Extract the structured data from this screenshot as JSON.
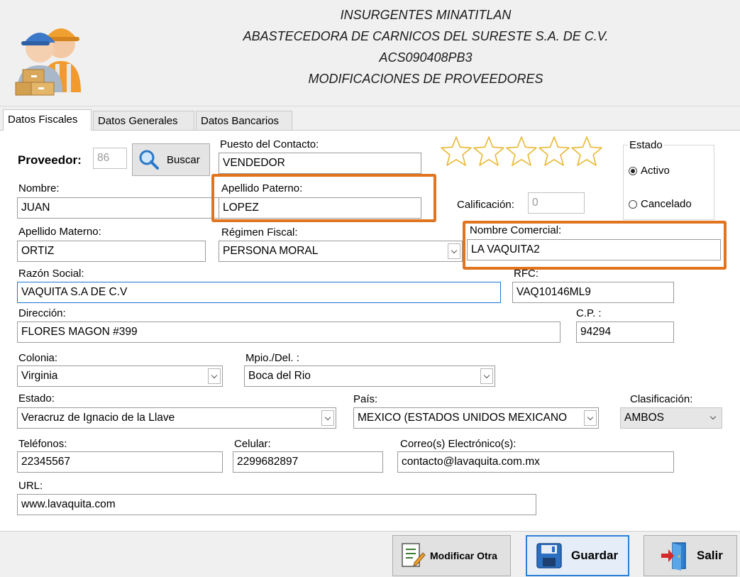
{
  "header": {
    "line1": "INSURGENTES MINATITLAN",
    "line2": "ABASTECEDORA DE CARNICOS DEL SURESTE S.A. DE C.V.",
    "line3": "ACS090408PB3",
    "line4": "MODIFICACIONES DE PROVEEDORES",
    "logo_icon": "suppliers-icon"
  },
  "tabs": [
    {
      "label": "Datos Fiscales",
      "active": true
    },
    {
      "label": "Datos Generales",
      "active": false
    },
    {
      "label": "Datos Bancarios",
      "active": false
    }
  ],
  "form": {
    "proveedor_label": "Proveedor:",
    "proveedor_value": "86",
    "buscar_label": "Buscar",
    "puesto_label": "Puesto del Contacto:",
    "puesto_value": "VENDEDOR",
    "nombre_label": "Nombre:",
    "nombre_value": "JUAN",
    "apellido_paterno_label": "Apellido Paterno:",
    "apellido_paterno_value": "LOPEZ",
    "calificacion_label": "Calificación:",
    "calificacion_value": "0",
    "rating_stars_filled": 0,
    "rating_stars_total": 5,
    "apellido_materno_label": "Apellido Materno:",
    "apellido_materno_value": "ORTIZ",
    "regimen_label": "Régimen Fiscal:",
    "regimen_value": "PERSONA MORAL",
    "nombre_comercial_label": "Nombre Comercial:",
    "nombre_comercial_value": "LA VAQUITA2",
    "razon_label": "Razón Social:",
    "razon_value": "VAQUITA S.A DE C.V",
    "rfc_label": "RFC:",
    "rfc_value": "VAQ10146ML9",
    "direccion_label": "Dirección:",
    "direccion_value": "FLORES MAGON #399",
    "cp_label": "C.P. :",
    "cp_value": "94294",
    "colonia_label": "Colonia:",
    "colonia_value": "Virginia",
    "mpio_label": "Mpio./Del. :",
    "mpio_value": "Boca del Rio",
    "estado_label": "Estado:",
    "estado_value": "Veracruz de Ignacio de la Llave",
    "pais_label": "País:",
    "pais_value": "MEXICO (ESTADOS UNIDOS MEXICANO",
    "clasificacion_label": "Clasificación:",
    "clasificacion_value": "AMBOS",
    "telefonos_label": "Teléfonos:",
    "telefonos_value": "22345567",
    "celular_label": "Celular:",
    "celular_value": "2299682897",
    "correo_label": "Correo(s) Electrónico(s):",
    "correo_value": "contacto@lavaquita.com.mx",
    "url_label": "URL:",
    "url_value": "www.lavaquita.com"
  },
  "status_group": {
    "title": "Estado",
    "options": [
      {
        "label": "Activo",
        "selected": true
      },
      {
        "label": "Cancelado",
        "selected": false
      }
    ]
  },
  "footer": {
    "modificar_label": "Modificar Otra",
    "guardar_label": "Guardar",
    "salir_label": "Salir"
  },
  "colors": {
    "highlight": "#e0741f",
    "focus_border": "#1e74d2"
  }
}
